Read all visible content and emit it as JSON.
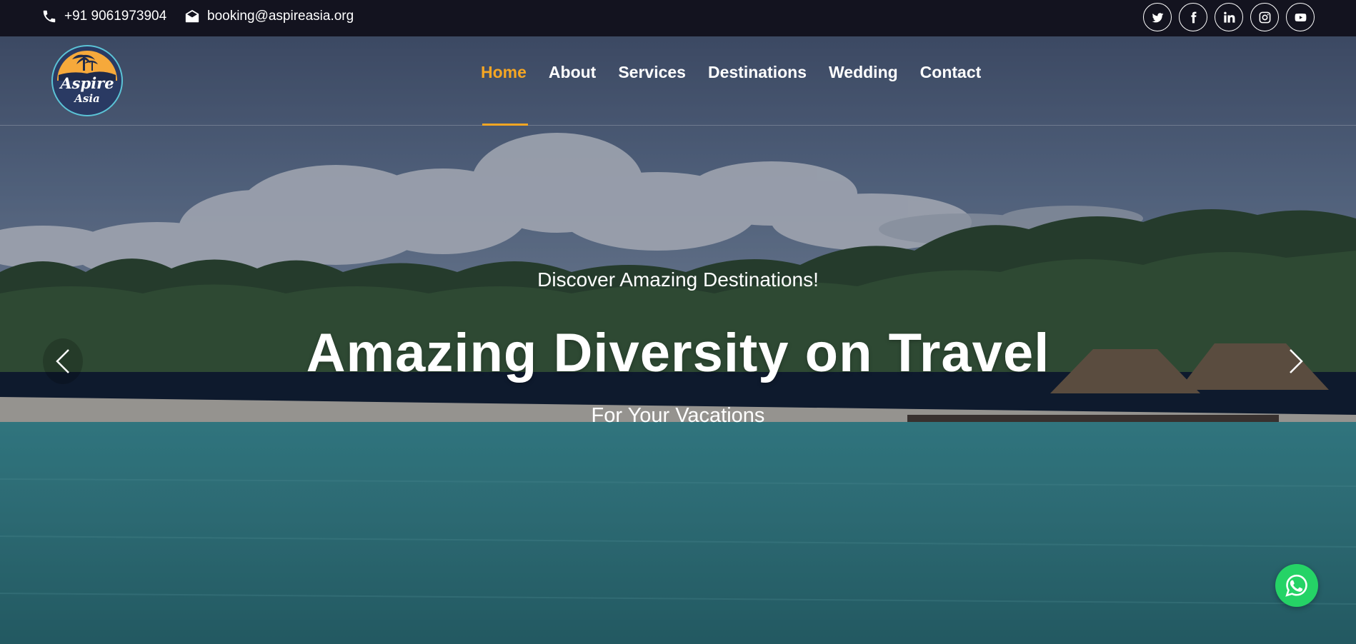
{
  "topbar": {
    "phone": "+91 9061973904",
    "email": "booking@aspireasia.org",
    "phone_icon": "phone-icon",
    "email_icon": "envelope-open-icon",
    "socials": [
      "twitter-icon",
      "facebook-icon",
      "linkedin-icon",
      "instagram-icon",
      "youtube-icon"
    ]
  },
  "logo": {
    "line1": "Aspire",
    "line2": "Asia"
  },
  "nav": {
    "items": [
      "Home",
      "About",
      "Services",
      "Destinations",
      "Wedding",
      "Contact"
    ],
    "active": "Home"
  },
  "hero": {
    "tagline": "Discover Amazing Destinations!",
    "headline": "Amazing Diversity on Travel",
    "subline": "For Your Vacations"
  },
  "colors": {
    "accent": "#f5a623",
    "topbar": "#13131f",
    "whatsapp": "#25d366"
  }
}
